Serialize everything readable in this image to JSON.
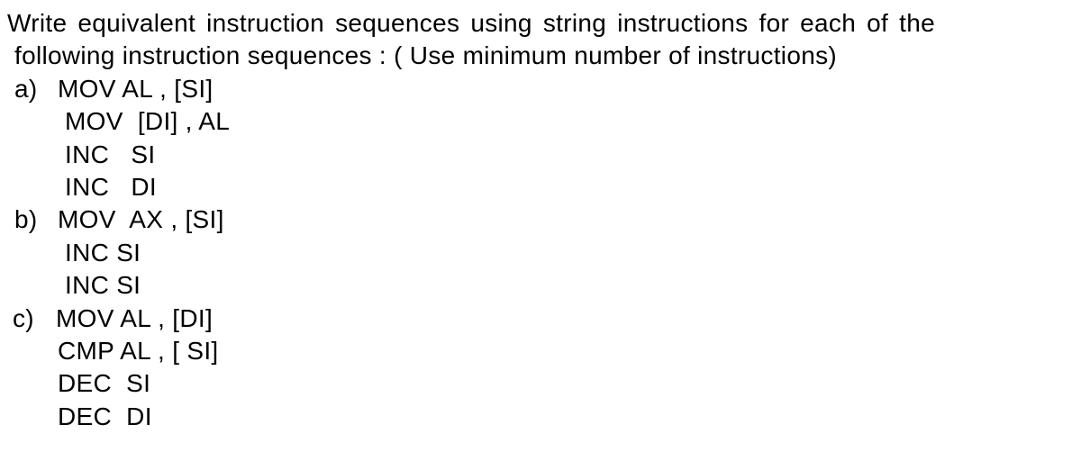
{
  "question": {
    "line1": "Write  equivalent  instruction sequences using string instructions for each of the",
    "line2": "following instruction sequences : ( Use minimum number of instructions)"
  },
  "parts": {
    "a": {
      "label": "a)",
      "lines": [
        "MOV AL , [SI]",
        "MOV  [DI] , AL",
        "INC   SI",
        "INC   DI"
      ]
    },
    "b": {
      "label": "b)",
      "lines": [
        "MOV  AX , [SI]",
        "INC SI",
        "INC SI"
      ]
    },
    "c": {
      "label": "c)",
      "lines": [
        "MOV AL , [DI]",
        "CMP AL , [ SI]",
        "DEC  SI",
        "DEC  DI"
      ]
    }
  }
}
